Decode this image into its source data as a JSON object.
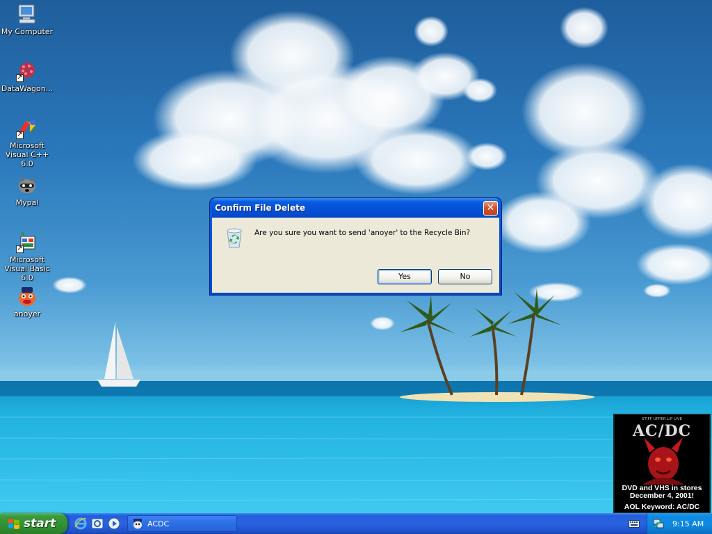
{
  "desktop": {
    "icons": [
      {
        "label": "My Computer",
        "icon": "my-computer-icon"
      },
      {
        "label": "DataWagon...",
        "icon": "datawagon-icon"
      },
      {
        "label": "Microsoft Visual C++ 6.0",
        "icon": "visual-cpp-icon"
      },
      {
        "label": "Mypal",
        "icon": "mypal-icon"
      },
      {
        "label": "Microsoft Visual Basic 6.0",
        "icon": "visual-basic-icon"
      },
      {
        "label": "anoyer",
        "icon": "anoyer-icon"
      }
    ]
  },
  "dialog": {
    "title": "Confirm File Delete",
    "message": "Are you sure you want to send 'anoyer' to the Recycle Bin?",
    "yes_label": "Yes",
    "no_label": "No",
    "icon": "recycle-bin-icon"
  },
  "ad": {
    "tagline": "STIFF UPPER LIP LIVE",
    "band": "AC/DC",
    "promo_line1": "DVD and VHS in stores",
    "promo_line2": "December 4, 2001!",
    "aol": "AOL Keyword: AC/DC"
  },
  "taskbar": {
    "start_label": "start",
    "quick_launch": [
      "internet-explorer-icon",
      "outlook-express-icon",
      "media-player-icon"
    ],
    "task_label": "ACDC",
    "clock": "9:15 AM"
  },
  "colors": {
    "taskbar_blue": "#245edb",
    "start_green": "#3c9a3c",
    "tray_blue": "#0f86dd",
    "dialog_face": "#ece9d8",
    "title_blue": "#0350d8"
  }
}
